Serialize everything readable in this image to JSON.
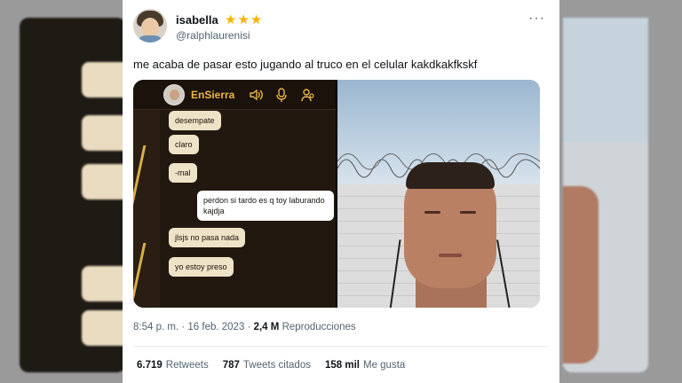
{
  "tweet": {
    "author_name": "isabella",
    "author_badge_icon": "star-icons",
    "author_stars": "★★★",
    "author_handle": "@ralphlaurenisi",
    "more_icon": "more-icon",
    "text": "me acaba de pasar esto jugando al truco en el celular kakdkakfkskf",
    "time": "8:54 p. m.",
    "date": "16 feb. 2023",
    "separator": "·",
    "views_count": "2,4 M",
    "views_label": "Reproducciones",
    "retweets_count": "6.719",
    "retweets_label": "Retweets",
    "quotes_count": "787",
    "quotes_label": "Tweets citados",
    "likes_count": "158 mil",
    "likes_label": "Me gusta"
  },
  "chat": {
    "contact_name": "EnSierra",
    "icons": [
      "speaker-icon",
      "microphone-icon",
      "people-icon"
    ],
    "messages": [
      {
        "text": "desempate",
        "side": "left"
      },
      {
        "text": "claro",
        "side": "left"
      },
      {
        "text": "-mal",
        "side": "left"
      },
      {
        "text": "perdon si tardo es q toy laburando kajdja",
        "side": "right"
      },
      {
        "text": "jlsjs no pasa nada",
        "side": "left"
      },
      {
        "text": "yo estoy preso",
        "side": "left"
      }
    ]
  },
  "colors": {
    "accent_gold": "#e8b64a",
    "bubble": "#efe3c7",
    "star": "#f4b400"
  }
}
